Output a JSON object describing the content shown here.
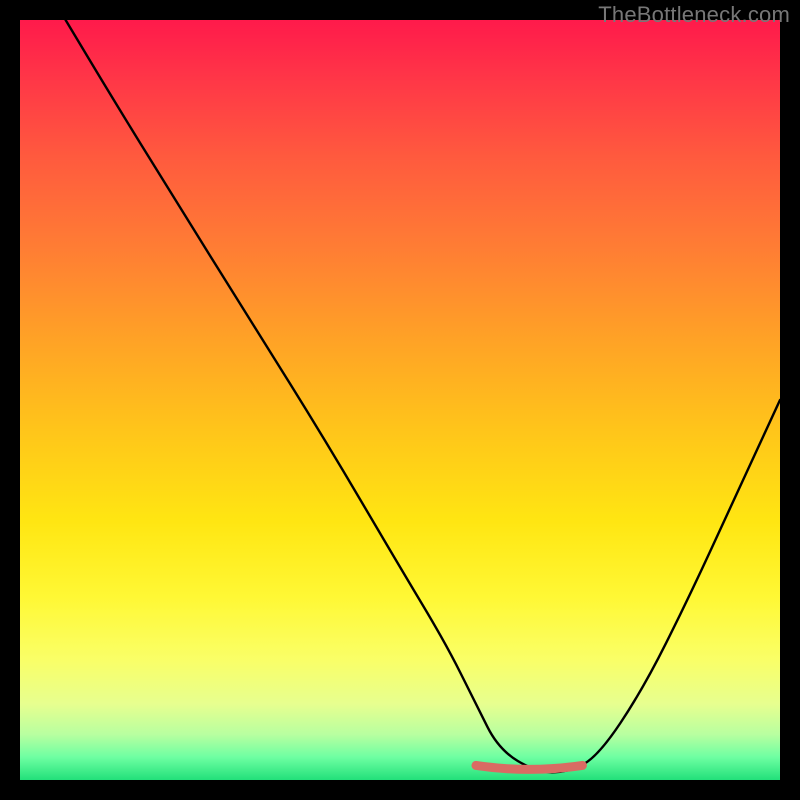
{
  "watermark": "TheBottleneck.com",
  "colors": {
    "frame": "#000000",
    "curve": "#000000",
    "marker": "#d96b63",
    "gradient_top": "#ff1a4b",
    "gradient_bottom": "#22e07a"
  },
  "chart_data": {
    "type": "line",
    "title": "",
    "xlabel": "",
    "ylabel": "",
    "xlim": [
      0,
      100
    ],
    "ylim": [
      0,
      100
    ],
    "grid": false,
    "legend": false,
    "series": [
      {
        "name": "bottleneck-curve",
        "x": [
          6,
          12,
          20,
          30,
          40,
          50,
          56,
          60,
          63,
          68,
          72,
          76,
          82,
          88,
          94,
          100
        ],
        "values": [
          100,
          90,
          77,
          61,
          45,
          28,
          18,
          10,
          4,
          1,
          1,
          3,
          12,
          24,
          37,
          50
        ]
      }
    ],
    "annotations": [
      {
        "name": "optimal-range-marker",
        "x_start": 60,
        "x_end": 74,
        "y": 1
      }
    ]
  }
}
